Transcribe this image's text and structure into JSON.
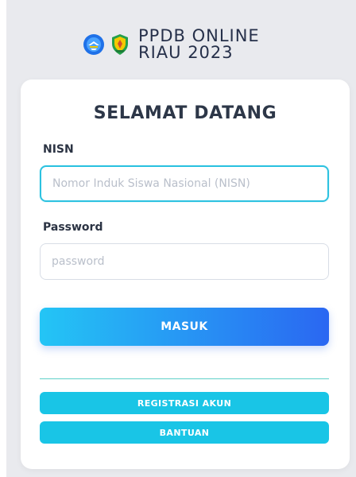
{
  "header": {
    "logo_line1": "PPDB ONLINE",
    "logo_line2": "RIAU 2023",
    "colors": {
      "emblem_blue": "#1f71e8",
      "emblem_yellow": "#f4c900",
      "riau_green": "#25a04a"
    }
  },
  "form": {
    "title": "SELAMAT DATANG",
    "nisn_label": "NISN",
    "nisn_placeholder": "Nomor Induk Siswa Nasional (NISN)",
    "password_label": "Password",
    "password_placeholder": "password",
    "login_label": "MASUK",
    "register_label": "REGISTRASI AKUN",
    "help_label": "BANTUAN"
  },
  "theme": {
    "background": "#e9eaee",
    "card": "#ffffff",
    "primary_start": "#24c5f5",
    "primary_end": "#2a67f2",
    "secondary": "#19c5e6",
    "focus": "#2cc2e0"
  }
}
